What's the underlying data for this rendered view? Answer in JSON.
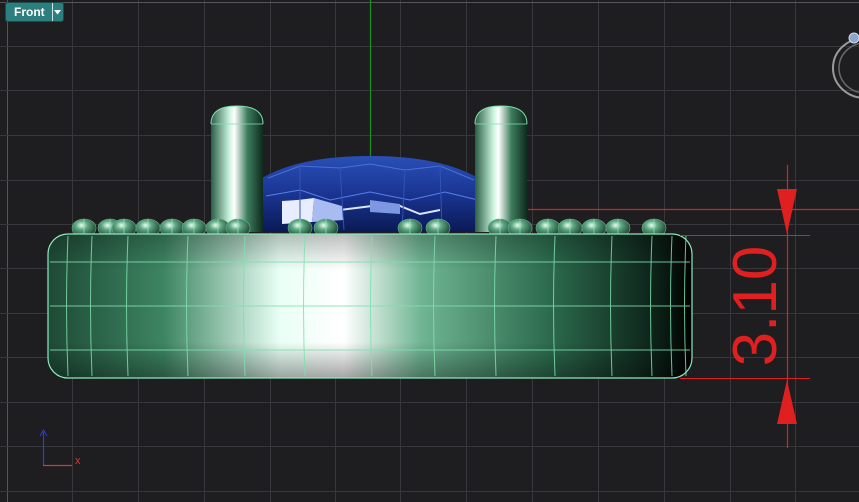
{
  "viewport": {
    "name": "Front",
    "menu_icon": "chevron-down-icon"
  },
  "dimension": {
    "value": "3.10",
    "color": "#e02020"
  },
  "axis_widget": {
    "x_label": "x"
  },
  "colors": {
    "background": "#1e1e20",
    "grid": "#3a3a3e",
    "grid_major": "#5a5a60",
    "y_axis": "#1f8f1f",
    "ring_metal": "#3f8a64",
    "ring_wire": "#7fe0b0",
    "gem": "#1a3a9a"
  }
}
